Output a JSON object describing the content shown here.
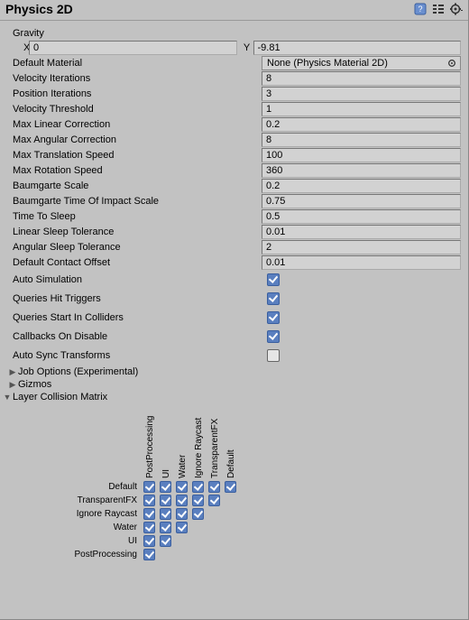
{
  "header": {
    "title": "Physics 2D"
  },
  "gravity": {
    "label": "Gravity",
    "x_label": "X",
    "x": "0",
    "y_label": "Y",
    "y": "-9.81"
  },
  "defaultMaterial": {
    "label": "Default Material",
    "value": "None (Physics Material 2D)"
  },
  "fields": [
    {
      "label": "Velocity Iterations",
      "value": "8"
    },
    {
      "label": "Position Iterations",
      "value": "3"
    },
    {
      "label": "Velocity Threshold",
      "value": "1"
    },
    {
      "label": "Max Linear Correction",
      "value": "0.2"
    },
    {
      "label": "Max Angular Correction",
      "value": "8"
    },
    {
      "label": "Max Translation Speed",
      "value": "100"
    },
    {
      "label": "Max Rotation Speed",
      "value": "360"
    },
    {
      "label": "Baumgarte Scale",
      "value": "0.2"
    },
    {
      "label": "Baumgarte Time Of Impact Scale",
      "value": "0.75"
    },
    {
      "label": "Time To Sleep",
      "value": "0.5"
    },
    {
      "label": "Linear Sleep Tolerance",
      "value": "0.01"
    },
    {
      "label": "Angular Sleep Tolerance",
      "value": "2"
    },
    {
      "label": "Default Contact Offset",
      "value": "0.01"
    }
  ],
  "toggles": {
    "autoSimulation": {
      "label": "Auto Simulation",
      "value": true
    },
    "queriesHitTriggers": {
      "label": "Queries Hit Triggers",
      "value": true
    },
    "queriesStartInColliders": {
      "label": "Queries Start In Colliders",
      "value": true
    },
    "callbacksOnDisable": {
      "label": "Callbacks On Disable",
      "value": true
    },
    "autoSyncTransforms": {
      "label": "Auto Sync Transforms",
      "value": false
    }
  },
  "foldouts": {
    "jobOptions": {
      "label": "Job Options (Experimental)",
      "expanded": false
    },
    "gizmos": {
      "label": "Gizmos",
      "expanded": false
    },
    "layerCollisionMatrix": {
      "label": "Layer Collision Matrix",
      "expanded": true
    }
  },
  "matrix": {
    "layers": [
      "Default",
      "TransparentFX",
      "Ignore Raycast",
      "Water",
      "UI",
      "PostProcessing"
    ]
  }
}
